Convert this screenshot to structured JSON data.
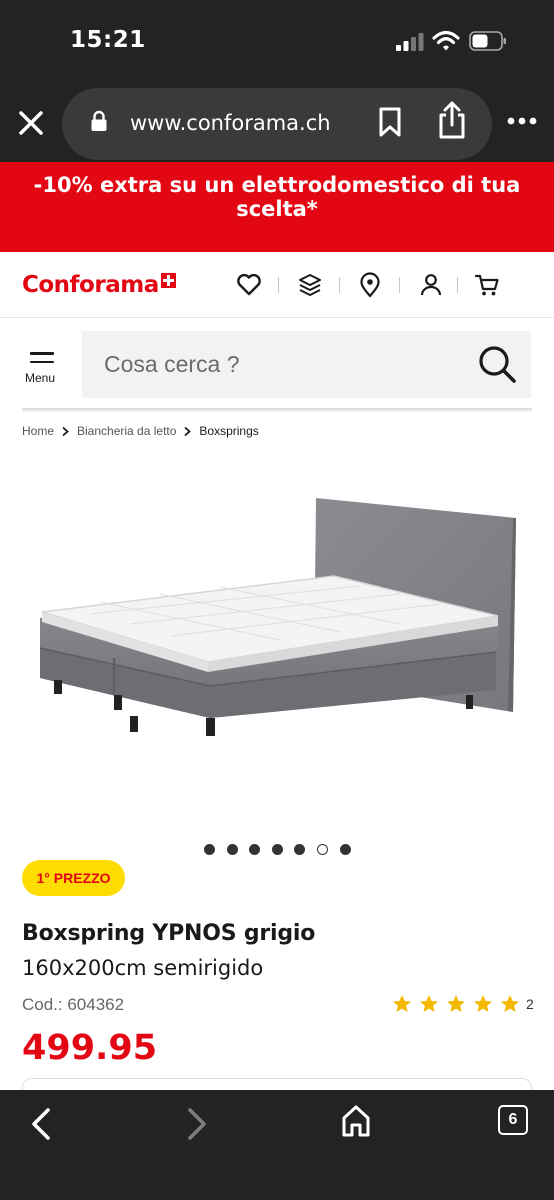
{
  "status_bar": {
    "time": "15:21"
  },
  "browser": {
    "url": "www.conforama.ch",
    "tab_count": "6"
  },
  "promo": {
    "text": "-10% extra su un elettrodomestico di tua scelta*"
  },
  "header": {
    "logo": "Conforama"
  },
  "search": {
    "menu_label": "Menu",
    "placeholder": "Cosa cerca ?"
  },
  "breadcrumb": [
    "Home",
    "Biancheria da letto",
    "Boxsprings"
  ],
  "carousel": {
    "total": 7,
    "current_index": 5
  },
  "product": {
    "badge": "1° PREZZO",
    "title": "Boxspring YPNOS grigio",
    "subtitle": "160x200cm semirigido",
    "code": "Cod.: 604362",
    "rating": 5,
    "review_count": "2",
    "price": "499.95"
  },
  "colors": {
    "brand_red": "#e30613",
    "badge_yellow": "#ffdc00",
    "star_yellow": "#f5b800",
    "chrome_dark": "#232323"
  }
}
